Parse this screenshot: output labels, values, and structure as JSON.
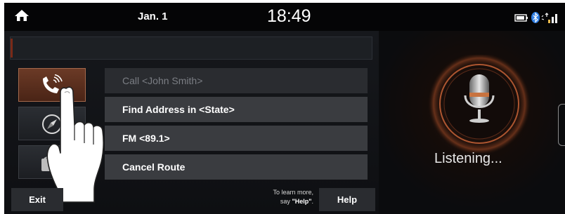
{
  "status_bar": {
    "date": "Jan. 1",
    "time": "18:49",
    "icons": [
      "home-icon",
      "battery-icon",
      "bluetooth-icon",
      "signal-icon"
    ]
  },
  "commands": [
    {
      "label": "Call <John Smith>",
      "icon": "phone-icon",
      "state": "dimmed"
    },
    {
      "label": "Find Address in <State>",
      "icon": "compass-icon",
      "state": "normal"
    },
    {
      "label": "FM <89.1>",
      "icon": "radio-icon",
      "state": "normal"
    },
    {
      "label": "Cancel Route",
      "icon": "",
      "state": "normal"
    }
  ],
  "footer": {
    "exit_label": "Exit",
    "help_hint_line1": "To learn more,",
    "help_hint_line2_prefix": "say ",
    "help_hint_keyword": "\"Help\"",
    "help_hint_suffix": ".",
    "help_label": "Help"
  },
  "voice": {
    "status": "Listening...",
    "icon": "microphone-icon"
  },
  "colors": {
    "accent": "#6b3a26",
    "background": "#0b0c0e",
    "button": "#3a3c40"
  }
}
